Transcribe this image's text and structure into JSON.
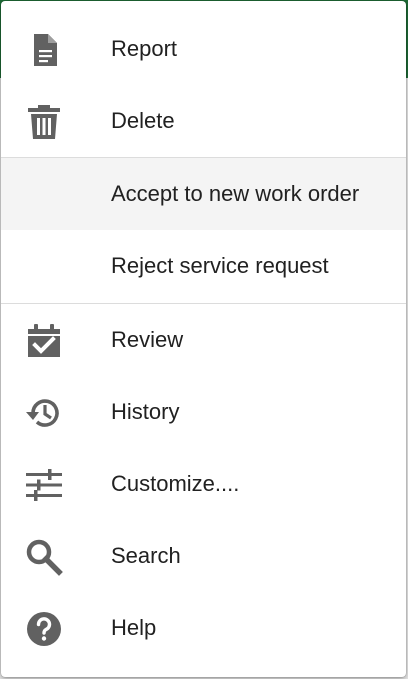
{
  "menu": {
    "items": [
      {
        "label": "Report",
        "icon": "report-document-icon"
      },
      {
        "label": "Delete",
        "icon": "trash-icon"
      },
      {
        "label": "Accept to new work order",
        "icon": null
      },
      {
        "label": "Reject service request",
        "icon": null
      },
      {
        "label": "Review",
        "icon": "calendar-check-icon"
      },
      {
        "label": "History",
        "icon": "history-icon"
      },
      {
        "label": "Customize....",
        "icon": "sliders-icon"
      },
      {
        "label": "Search",
        "icon": "search-icon"
      },
      {
        "label": "Help",
        "icon": "help-circle-icon"
      }
    ],
    "highlighted_index": 2
  },
  "colors": {
    "icon": "#616161",
    "text": "#212121",
    "highlight": "#f4f4f4",
    "divider": "#dcdcdc",
    "app_bar": "#1e6b36"
  }
}
